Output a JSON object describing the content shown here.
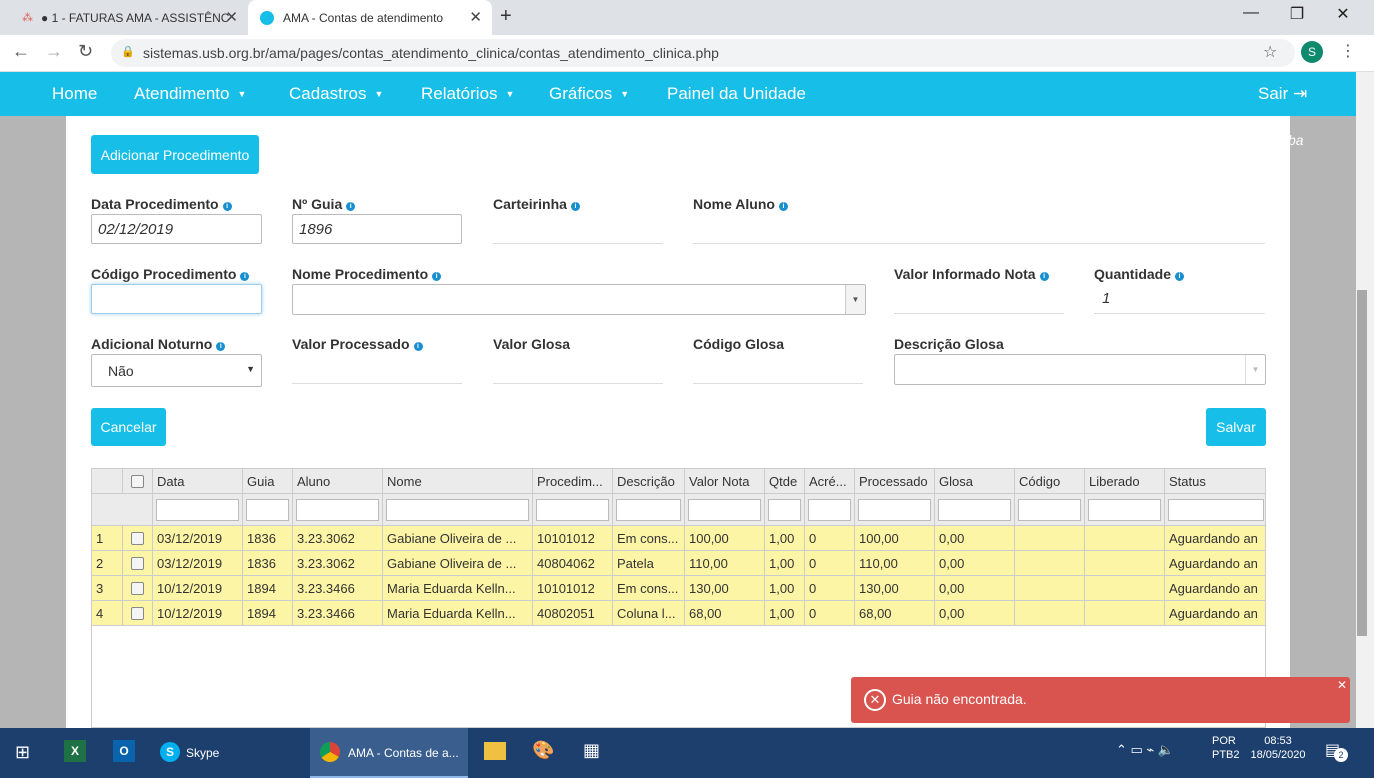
{
  "browser": {
    "tabs": [
      {
        "title": "● 1 - FATURAS AMA - ASSISTÊNC",
        "active": false
      },
      {
        "title": "AMA - Contas de atendimento",
        "active": true
      }
    ],
    "url": "sistemas.usb.org.br/ama/pages/contas_atendimento_clinica/contas_atendimento_clinica.php",
    "profile_initial": "S"
  },
  "nav": {
    "items": [
      "Home",
      "Atendimento",
      "Cadastros",
      "Relatórios",
      "Gráficos",
      "Painel da Unidade"
    ],
    "logout": "Sair",
    "bg_text": "ba"
  },
  "form": {
    "add_button": "Adicionar Procedimento",
    "data_procedimento": {
      "label": "Data Procedimento",
      "value": "02/12/2019"
    },
    "n_guia": {
      "label": "Nº Guia",
      "value": "1896"
    },
    "carteirinha": {
      "label": "Carteirinha",
      "value": ""
    },
    "nome_aluno": {
      "label": "Nome Aluno",
      "value": ""
    },
    "codigo_procedimento": {
      "label": "Código Procedimento",
      "value": ""
    },
    "nome_procedimento": {
      "label": "Nome Procedimento",
      "value": ""
    },
    "valor_informado": {
      "label": "Valor Informado Nota",
      "value": ""
    },
    "quantidade": {
      "label": "Quantidade",
      "value": "1"
    },
    "adicional_noturno": {
      "label": "Adicional Noturno",
      "value": "Não"
    },
    "valor_processado": {
      "label": "Valor Processado",
      "value": ""
    },
    "valor_glosa": {
      "label": "Valor Glosa",
      "value": ""
    },
    "codigo_glosa": {
      "label": "Código Glosa",
      "value": ""
    },
    "descricao_glosa": {
      "label": "Descrição Glosa",
      "value": ""
    },
    "cancel_button": "Cancelar",
    "save_button": "Salvar"
  },
  "grid": {
    "headers": [
      "Data",
      "Guia",
      "Aluno",
      "Nome",
      "Procedim...",
      "Descrição",
      "Valor Nota",
      "Qtde",
      "Acré...",
      "Processado",
      "Glosa",
      "Código",
      "Liberado",
      "Status"
    ],
    "rows": [
      [
        "1",
        "03/12/2019",
        "1836",
        "3.23.3062",
        "Gabiane Oliveira de ...",
        "10101012",
        "Em cons...",
        "100,00",
        "1,00",
        "0",
        "100,00",
        "0,00",
        "",
        "",
        "Aguardando an"
      ],
      [
        "2",
        "03/12/2019",
        "1836",
        "3.23.3062",
        "Gabiane Oliveira de ...",
        "40804062",
        "Patela",
        "110,00",
        "1,00",
        "0",
        "110,00",
        "0,00",
        "",
        "",
        "Aguardando an"
      ],
      [
        "3",
        "10/12/2019",
        "1894",
        "3.23.3466",
        "Maria Eduarda Kelln...",
        "10101012",
        "Em cons...",
        "130,00",
        "1,00",
        "0",
        "130,00",
        "0,00",
        "",
        "",
        "Aguardando an"
      ],
      [
        "4",
        "10/12/2019",
        "1894",
        "3.23.3466",
        "Maria Eduarda Kelln...",
        "40802051",
        "Coluna l...",
        "68,00",
        "1,00",
        "0",
        "68,00",
        "0,00",
        "",
        "",
        "Aguardando an"
      ]
    ]
  },
  "toast": {
    "message": "Guia não encontrada."
  },
  "taskbar": {
    "skype": "Skype",
    "chrome": "AMA - Contas de a...",
    "lang1": "POR",
    "lang2": "PTB2",
    "time": "08:53",
    "date": "18/05/2020",
    "notif": "2"
  },
  "colors": {
    "accent": "#17bfe8",
    "row_highlight": "#fdf5a6",
    "toast": "#d9534f"
  }
}
